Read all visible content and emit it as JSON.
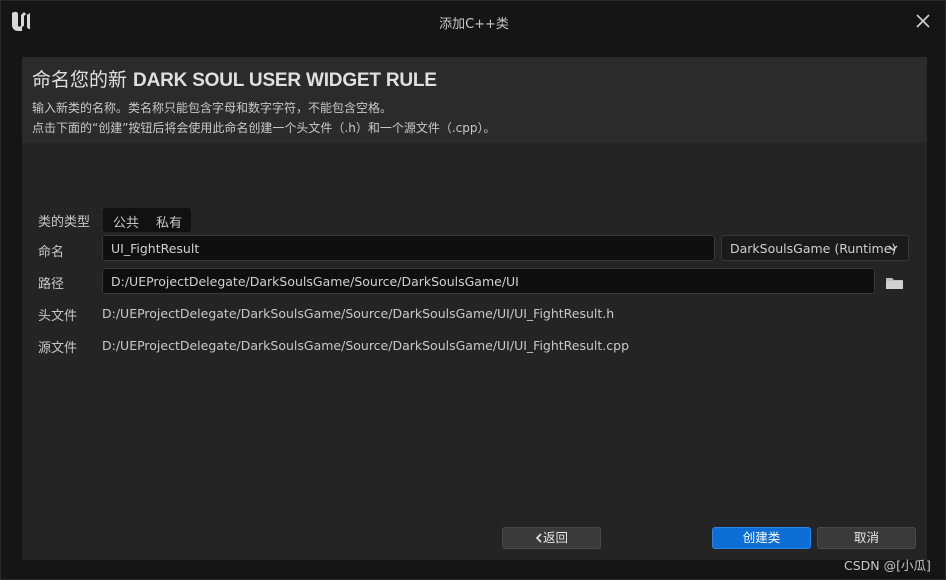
{
  "window": {
    "title": "添加C++类",
    "logo_icon": "unreal-engine-logo-icon",
    "close_icon": "close-icon"
  },
  "header": {
    "heading_prefix": "命名您的新 ",
    "class_name": "DARK SOUL USER WIDGET RULE",
    "desc_line1": "输入新类的名称。类名称只能包含字母和数字字符，不能包含空格。",
    "desc_line2": "点击下面的“创建”按钮后将会使用此命名创建一个头文件（.h）和一个源文件（.cpp）。"
  },
  "form": {
    "class_type": {
      "label": "类的类型",
      "options": [
        "公共",
        "私有"
      ]
    },
    "name": {
      "label": "命名",
      "value": "UI_FightResult"
    },
    "module": {
      "selected": "DarkSoulsGame (Runtime)",
      "icon": "chevron-down-icon"
    },
    "path": {
      "label": "路径",
      "value": "D:/UEProjectDelegate/DarkSoulsGame/Source/DarkSoulsGame/UI",
      "icon": "folder-icon"
    },
    "header_file": {
      "label": "头文件",
      "value": "D:/UEProjectDelegate/DarkSoulsGame/Source/DarkSoulsGame/UI/UI_FightResult.h"
    },
    "source_file": {
      "label": "源文件",
      "value": "D:/UEProjectDelegate/DarkSoulsGame/Source/DarkSoulsGame/UI/UI_FightResult.cpp"
    }
  },
  "buttons": {
    "back": "返回",
    "back_icon": "chevron-left-icon",
    "create": "创建类",
    "cancel": "取消"
  },
  "watermark": "CSDN @[小瓜]",
  "colors": {
    "accent": "#0d6fd6",
    "background": "#151515",
    "panel": "#242424"
  }
}
